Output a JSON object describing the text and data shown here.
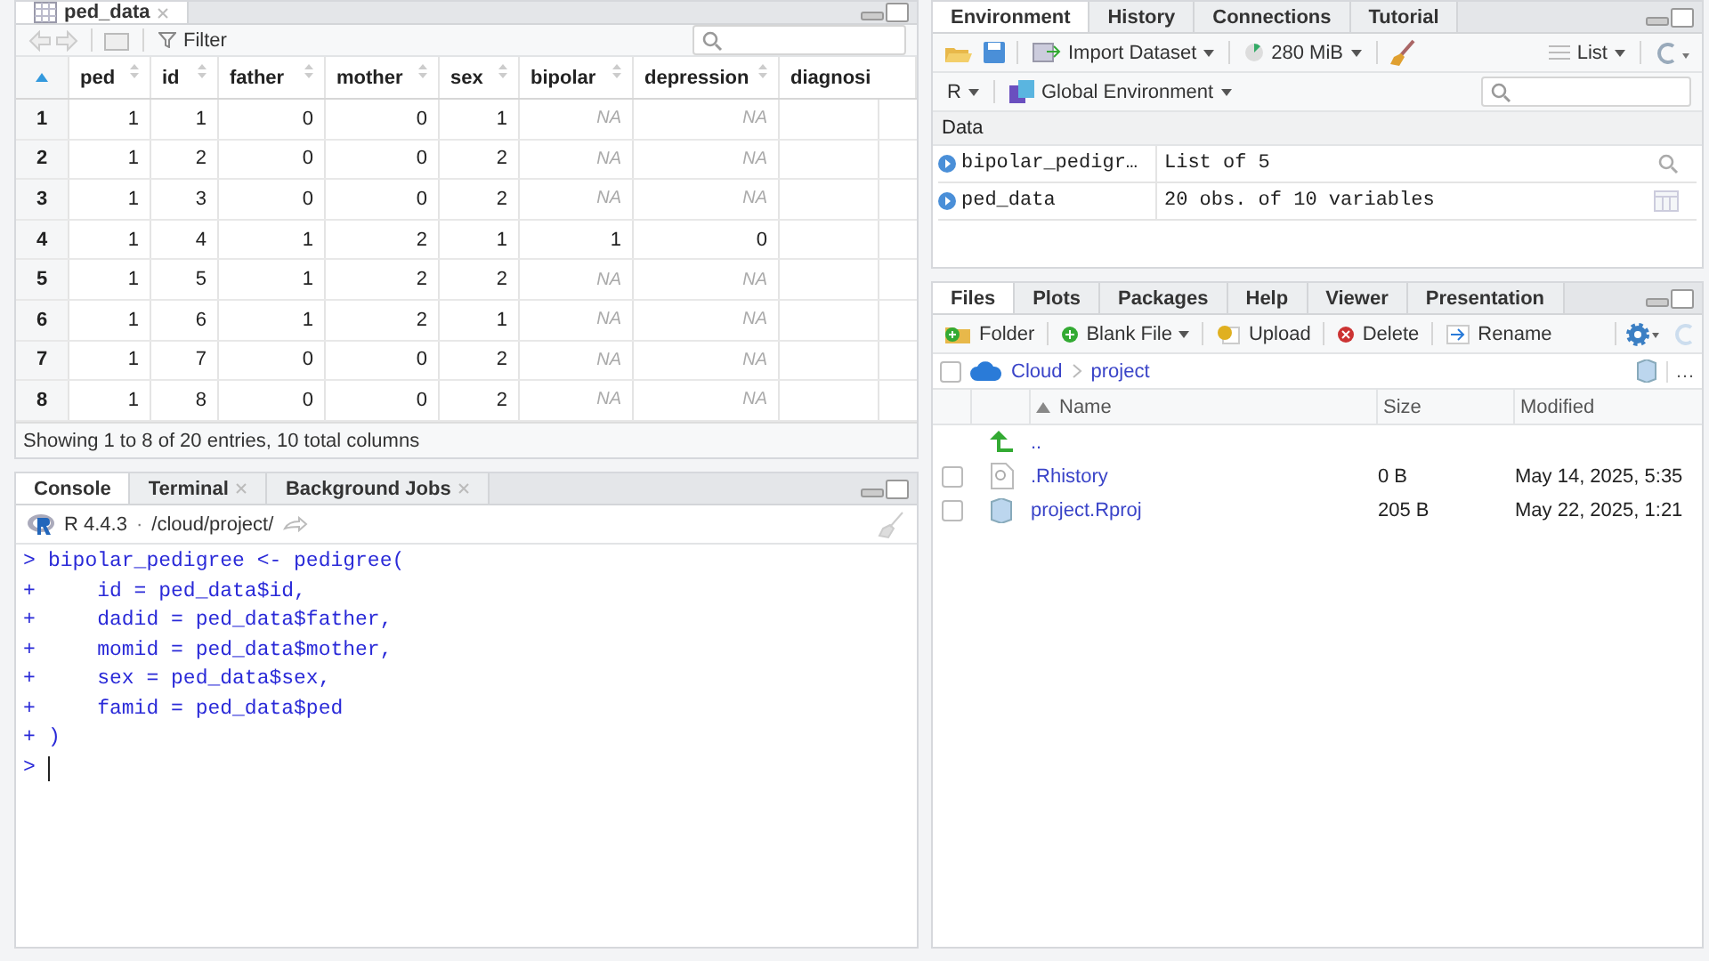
{
  "viewer": {
    "tab": {
      "label": "ped_data"
    },
    "filter_label": "Filter",
    "columns": [
      {
        "label": "ped",
        "sortable": true
      },
      {
        "label": "id",
        "sortable": true
      },
      {
        "label": "father",
        "sortable": true
      },
      {
        "label": "mother",
        "sortable": true
      },
      {
        "label": "sex",
        "sortable": true
      },
      {
        "label": "bipolar",
        "sortable": true
      },
      {
        "label": "depression",
        "sortable": true
      },
      {
        "label": "diagnosi",
        "sortable": false
      }
    ],
    "rows": [
      {
        "index": "1",
        "cells": [
          {
            "text": "1",
            "missing": false
          },
          {
            "text": "1",
            "missing": false
          },
          {
            "text": "0",
            "missing": false
          },
          {
            "text": "0",
            "missing": false
          },
          {
            "text": "1",
            "missing": false
          },
          {
            "text": "NA",
            "missing": true
          },
          {
            "text": "NA",
            "missing": true
          }
        ]
      },
      {
        "index": "2",
        "cells": [
          {
            "text": "1",
            "missing": false
          },
          {
            "text": "2",
            "missing": false
          },
          {
            "text": "0",
            "missing": false
          },
          {
            "text": "0",
            "missing": false
          },
          {
            "text": "2",
            "missing": false
          },
          {
            "text": "NA",
            "missing": true
          },
          {
            "text": "NA",
            "missing": true
          }
        ]
      },
      {
        "index": "3",
        "cells": [
          {
            "text": "1",
            "missing": false
          },
          {
            "text": "3",
            "missing": false
          },
          {
            "text": "0",
            "missing": false
          },
          {
            "text": "0",
            "missing": false
          },
          {
            "text": "2",
            "missing": false
          },
          {
            "text": "NA",
            "missing": true
          },
          {
            "text": "NA",
            "missing": true
          }
        ]
      },
      {
        "index": "4",
        "cells": [
          {
            "text": "1",
            "missing": false
          },
          {
            "text": "4",
            "missing": false
          },
          {
            "text": "1",
            "missing": false
          },
          {
            "text": "2",
            "missing": false
          },
          {
            "text": "1",
            "missing": false
          },
          {
            "text": "1",
            "missing": false
          },
          {
            "text": "0",
            "missing": false
          }
        ]
      },
      {
        "index": "5",
        "cells": [
          {
            "text": "1",
            "missing": false
          },
          {
            "text": "5",
            "missing": false
          },
          {
            "text": "1",
            "missing": false
          },
          {
            "text": "2",
            "missing": false
          },
          {
            "text": "2",
            "missing": false
          },
          {
            "text": "NA",
            "missing": true
          },
          {
            "text": "NA",
            "missing": true
          }
        ]
      },
      {
        "index": "6",
        "cells": [
          {
            "text": "1",
            "missing": false
          },
          {
            "text": "6",
            "missing": false
          },
          {
            "text": "1",
            "missing": false
          },
          {
            "text": "2",
            "missing": false
          },
          {
            "text": "1",
            "missing": false
          },
          {
            "text": "NA",
            "missing": true
          },
          {
            "text": "NA",
            "missing": true
          }
        ]
      },
      {
        "index": "7",
        "cells": [
          {
            "text": "1",
            "missing": false
          },
          {
            "text": "7",
            "missing": false
          },
          {
            "text": "0",
            "missing": false
          },
          {
            "text": "0",
            "missing": false
          },
          {
            "text": "2",
            "missing": false
          },
          {
            "text": "NA",
            "missing": true
          },
          {
            "text": "NA",
            "missing": true
          }
        ]
      },
      {
        "index": "8",
        "cells": [
          {
            "text": "1",
            "missing": false
          },
          {
            "text": "8",
            "missing": false
          },
          {
            "text": "0",
            "missing": false
          },
          {
            "text": "0",
            "missing": false
          },
          {
            "text": "2",
            "missing": false
          },
          {
            "text": "NA",
            "missing": true
          },
          {
            "text": "NA",
            "missing": true
          }
        ]
      }
    ],
    "status": "Showing 1 to 8 of 20 entries, 10 total columns"
  },
  "console": {
    "tabs": [
      {
        "label": "Console",
        "selected": true,
        "closable": false
      },
      {
        "label": "Terminal",
        "selected": false,
        "closable": true
      },
      {
        "label": "Background Jobs",
        "selected": false,
        "closable": true
      }
    ],
    "version": "R 4.4.3",
    "separator": "·",
    "path": "/cloud/project/",
    "lines": [
      {
        "prompt": ">",
        "code": "bipolar_pedigree <- pedigree("
      },
      {
        "prompt": "+",
        "code": "    id = ped_data$id,"
      },
      {
        "prompt": "+",
        "code": "    dadid = ped_data$father,"
      },
      {
        "prompt": "+",
        "code": "    momid = ped_data$mother,"
      },
      {
        "prompt": "+",
        "code": "    sex = ped_data$sex,"
      },
      {
        "prompt": "+",
        "code": "    famid = ped_data$ped"
      },
      {
        "prompt": "+",
        "code": ")"
      }
    ],
    "input_prompt": ">"
  },
  "environment": {
    "tabs": [
      {
        "label": "Environment",
        "selected": true
      },
      {
        "label": "History",
        "selected": false
      },
      {
        "label": "Connections",
        "selected": false
      },
      {
        "label": "Tutorial",
        "selected": false
      }
    ],
    "import_label": "Import Dataset",
    "memory": "280 MiB",
    "view_mode": "List",
    "language": "R",
    "scope": "Global Environment",
    "section": "Data",
    "items": [
      {
        "name": "bipolar_pedigr…",
        "value": "List of  5",
        "kind": "list"
      },
      {
        "name": "ped_data",
        "value": "20 obs. of 10 variables",
        "kind": "table"
      }
    ]
  },
  "files": {
    "tabs": [
      {
        "label": "Files",
        "selected": true
      },
      {
        "label": "Plots",
        "selected": false
      },
      {
        "label": "Packages",
        "selected": false
      },
      {
        "label": "Help",
        "selected": false
      },
      {
        "label": "Viewer",
        "selected": false
      },
      {
        "label": "Presentation",
        "selected": false
      }
    ],
    "toolbar": [
      {
        "label": "Folder",
        "kind": "folder",
        "dropdown": false
      },
      {
        "label": "Blank File",
        "kind": "new",
        "dropdown": true
      },
      {
        "label": "Upload",
        "kind": "upload",
        "dropdown": false
      },
      {
        "label": "Delete",
        "kind": "delete",
        "dropdown": false
      },
      {
        "label": "Rename",
        "kind": "rename",
        "dropdown": false
      }
    ],
    "all_checked": false,
    "breadcrumb": [
      "Cloud",
      "project"
    ],
    "more": "…",
    "columns": [
      "Name",
      "Size",
      "Modified"
    ],
    "rows": [
      {
        "name": "..",
        "kind": "parent"
      },
      {
        "name": ".Rhistory",
        "size": "0 B",
        "modified": "May 14, 2025, 5:35",
        "kind": "file",
        "checked": false
      },
      {
        "name": "project.Rproj",
        "size": "205 B",
        "modified": "May 22, 2025, 1:21",
        "kind": "project",
        "checked": false
      }
    ]
  }
}
